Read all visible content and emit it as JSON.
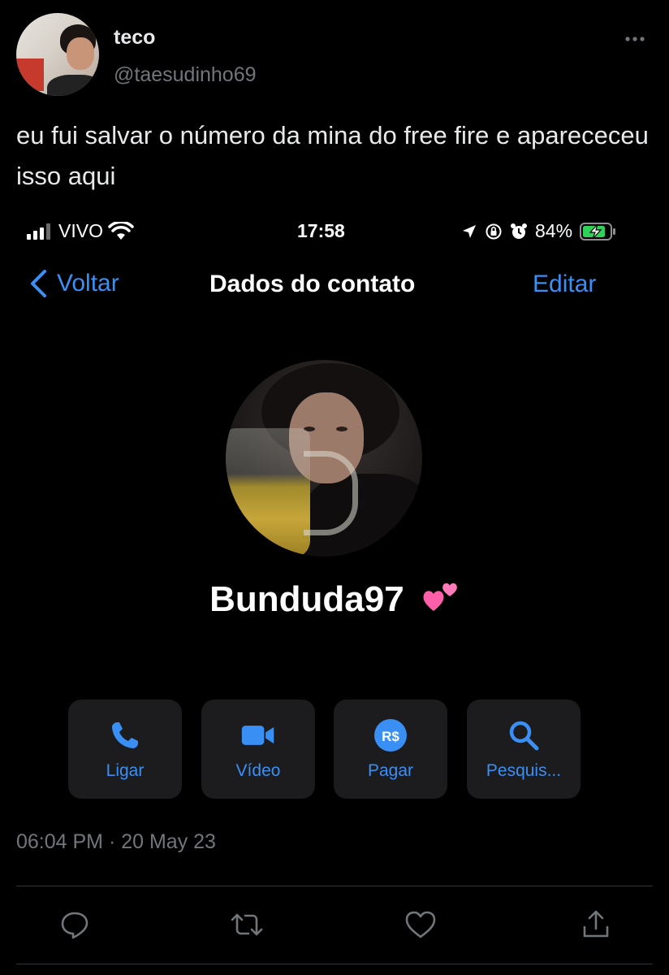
{
  "tweet": {
    "display_name": "teco",
    "handle": "@taesudinho69",
    "text": "eu fui salvar o número da mina do free fire e aparececeu isso aqui",
    "timestamp": "06:04 PM · 20 May 23"
  },
  "phone": {
    "status_bar": {
      "carrier": "VIVO",
      "time": "17:58",
      "battery": "84%"
    },
    "nav": {
      "back_label": "Voltar",
      "title": "Dados do contato",
      "edit_label": "Editar"
    },
    "contact": {
      "name": "Bunduda97",
      "emoji": "two-hearts-icon"
    },
    "actions": [
      {
        "label": "Ligar",
        "icon": "phone-icon"
      },
      {
        "label": "Vídeo",
        "icon": "video-camera-icon"
      },
      {
        "label": "Pagar",
        "icon": "real-currency-icon",
        "icon_text": "R$"
      },
      {
        "label": "Pesquis...",
        "icon": "search-icon"
      }
    ]
  },
  "colors": {
    "background": "#000000",
    "ios_accent": "#3a8ff5",
    "secondary_text": "#71767b",
    "button_bg": "#1c1c1e"
  }
}
